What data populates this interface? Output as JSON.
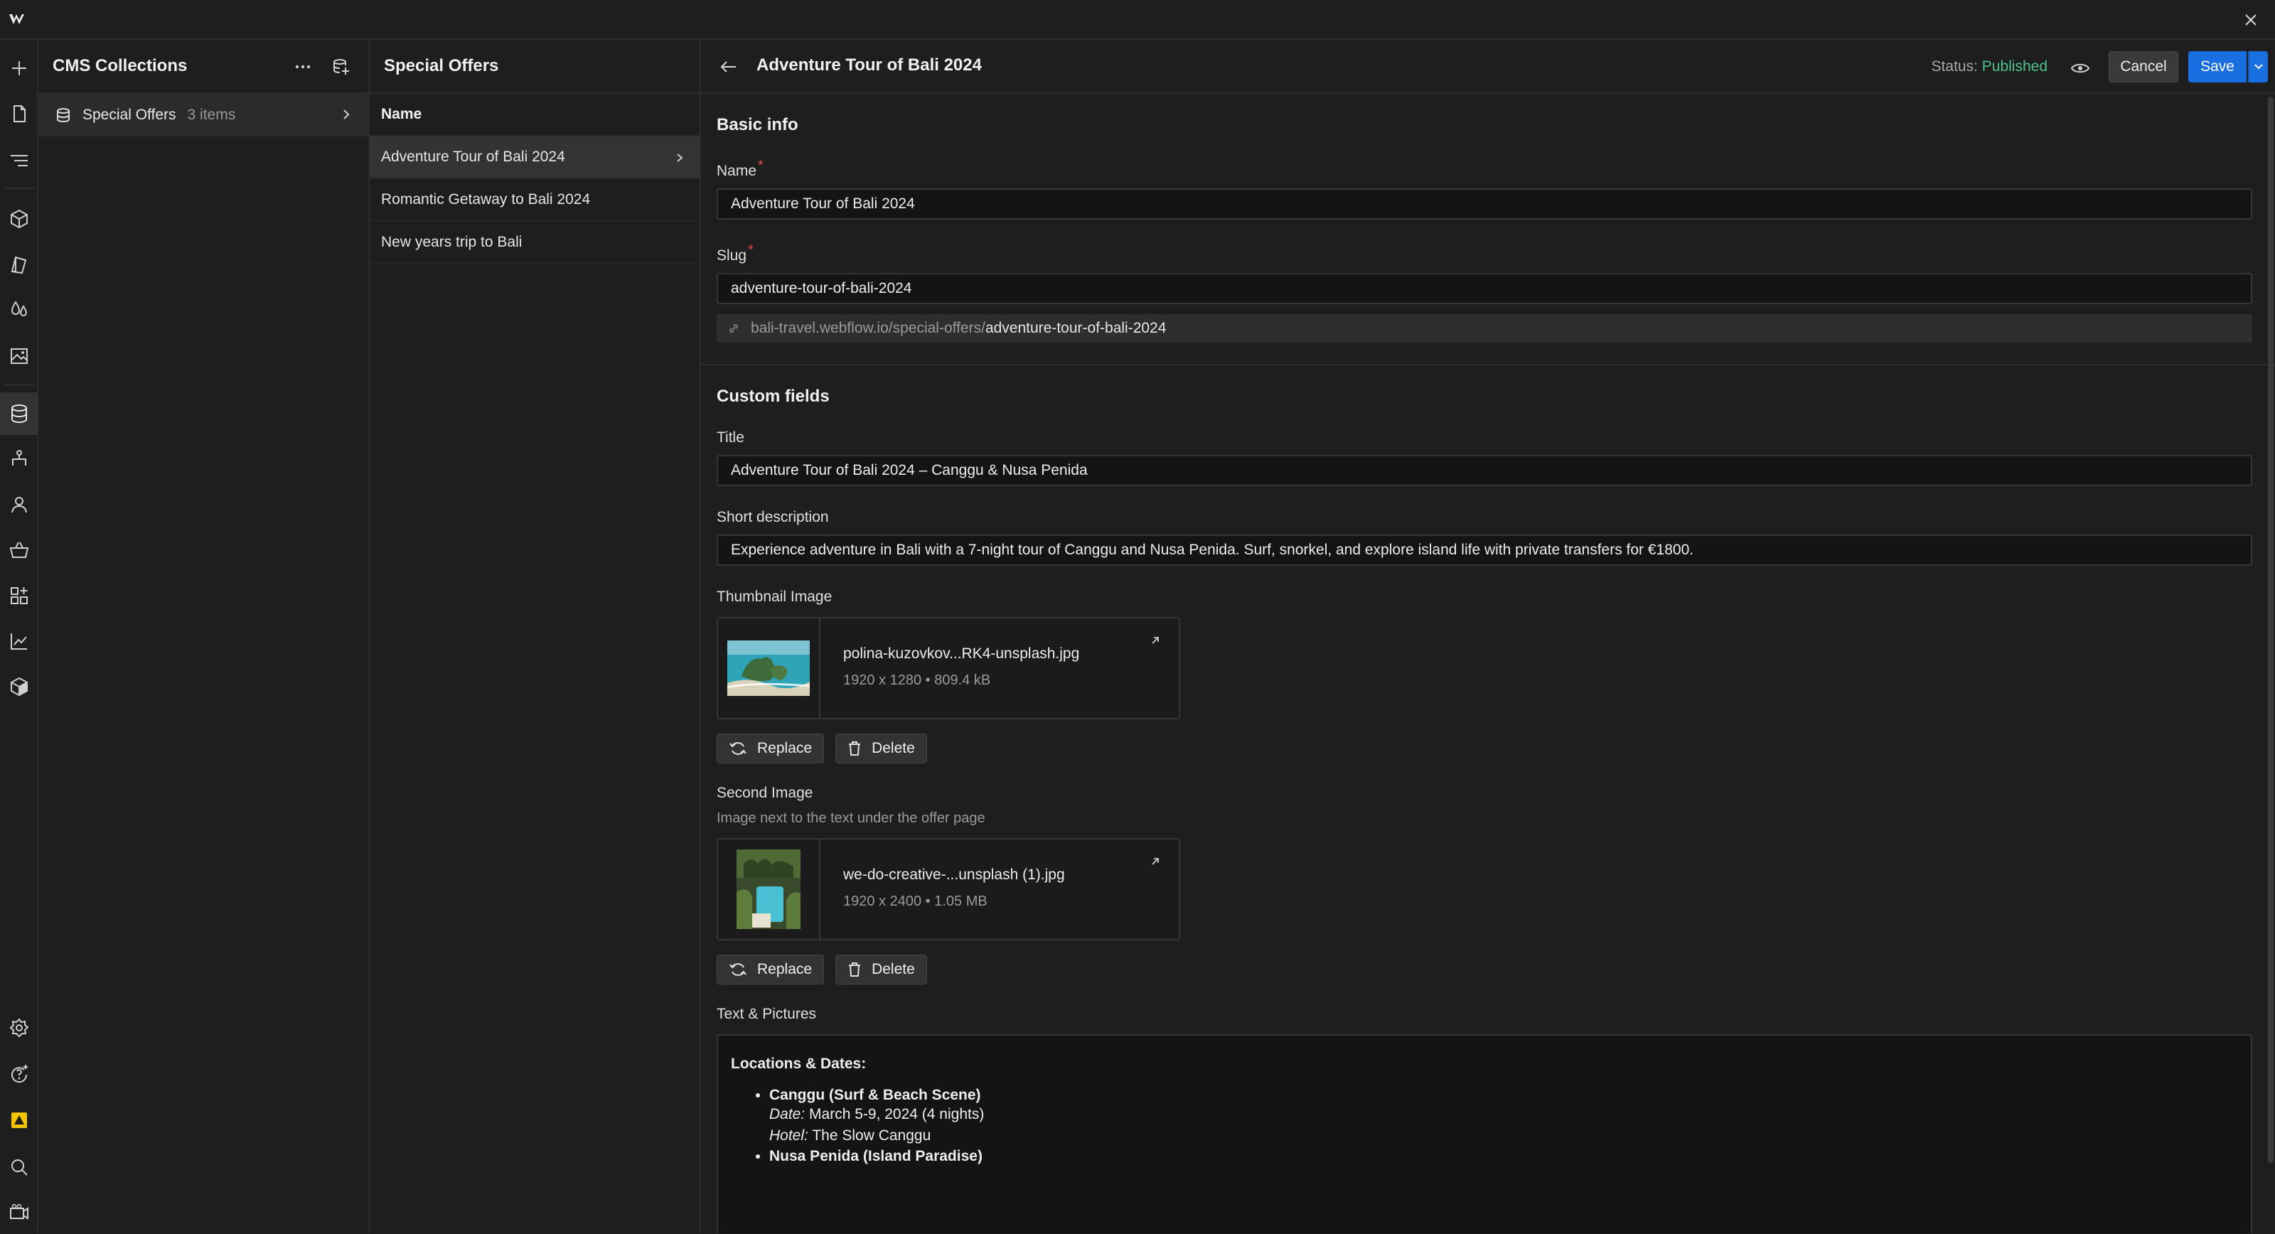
{
  "app": {
    "colors": {
      "accent": "#1a6fe0",
      "published": "#4cc38a",
      "required": "#e5484d",
      "warning": "#f5c400"
    }
  },
  "rail": {
    "items": [
      "add-icon",
      "pages-icon",
      "navigator-icon",
      "components-icon",
      "style-guide-icon",
      "variables-icon",
      "assets-icon",
      "cms-icon",
      "logic-icon",
      "users-icon",
      "ecommerce-icon",
      "apps-icon",
      "insights-icon",
      "libraries-icon",
      "settings-icon",
      "help-icon",
      "audit-icon",
      "search-icon",
      "video-icon"
    ]
  },
  "collections": {
    "title": "CMS Collections",
    "items": [
      {
        "label": "Special Offers",
        "count": "3 items"
      }
    ]
  },
  "items_panel": {
    "title": "Special Offers",
    "column": "Name",
    "rows": [
      "Adventure Tour of Bali 2024",
      "Romantic Getaway to Bali 2024",
      "New years trip to Bali"
    ]
  },
  "editor": {
    "title": "Adventure Tour of Bali 2024",
    "status_label": "Status:",
    "status_value": "Published",
    "cancel_label": "Cancel",
    "save_label": "Save",
    "basic_info": {
      "heading": "Basic info",
      "name_label": "Name",
      "name_value": "Adventure Tour of Bali 2024",
      "slug_label": "Slug",
      "slug_value": "adventure-tour-of-bali-2024",
      "url_base": "bali-travel.webflow.io/special-offers/",
      "url_slug": "adventure-tour-of-bali-2024"
    },
    "custom_fields": {
      "heading": "Custom fields",
      "title_label": "Title",
      "title_value": "Adventure Tour of Bali 2024 – Canggu & Nusa Penida",
      "short_desc_label": "Short description",
      "short_desc_value": "Experience adventure in Bali with a 7-night tour of Canggu and Nusa Penida. Surf, snorkel, and explore island life with private transfers for €1800.",
      "thumb_label": "Thumbnail Image",
      "thumb": {
        "file": "polina-kuzovkov...RK4-unsplash.jpg",
        "meta": "1920 x 1280 • 809.4 kB"
      },
      "second_label": "Second Image",
      "second_hint": "Image next to the text under the offer page",
      "second": {
        "file": "we-do-creative-...unsplash (1).jpg",
        "meta": "1920 x 2400 • 1.05 MB"
      },
      "replace_label": "Replace",
      "delete_label": "Delete",
      "rich_label": "Text & Pictures",
      "rich": {
        "heading": "Locations & Dates:",
        "loc1_title": "Canggu (Surf & Beach Scene)",
        "loc1_date_label": "Date:",
        "loc1_date": "March 5-9, 2024 (4 nights)",
        "loc1_hotel_label": "Hotel:",
        "loc1_hotel": "The Slow Canggu",
        "loc2_title": "Nusa Penida (Island Paradise)"
      }
    }
  }
}
